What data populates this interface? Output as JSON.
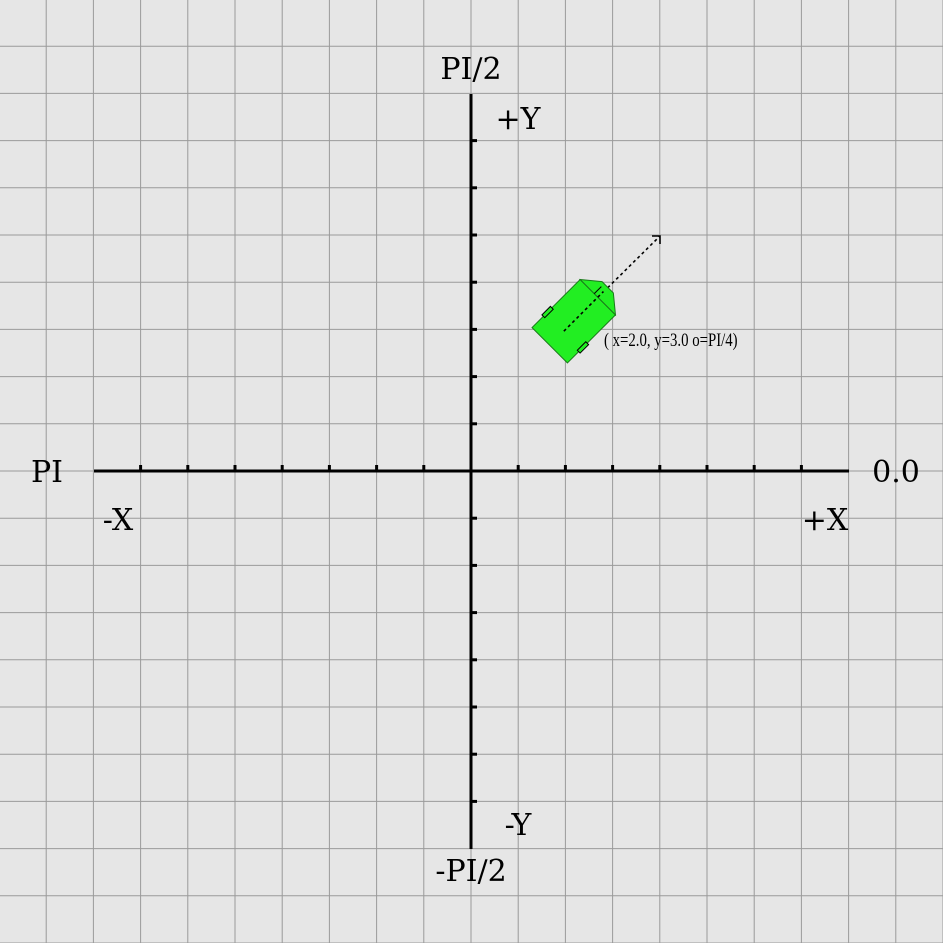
{
  "labels": {
    "angle_top": "PI/2",
    "angle_bottom": "-PI/2",
    "angle_left": "PI",
    "angle_right": "0.0",
    "axis_pos_y": "+Y",
    "axis_neg_y": "-Y",
    "axis_neg_x": "-X",
    "axis_pos_x": "+X"
  },
  "robot": {
    "x": 2.0,
    "y": 3.0,
    "orientation": "PI/4",
    "pose_label": "( x=2.0, y=3.0 o=PI/4)",
    "body_color": "#22ee22"
  },
  "grid": {
    "color": "#9a9a9a",
    "background": "#e6e6e6"
  },
  "axes": {
    "tick_range": [
      -7,
      7
    ],
    "color": "#000000"
  }
}
